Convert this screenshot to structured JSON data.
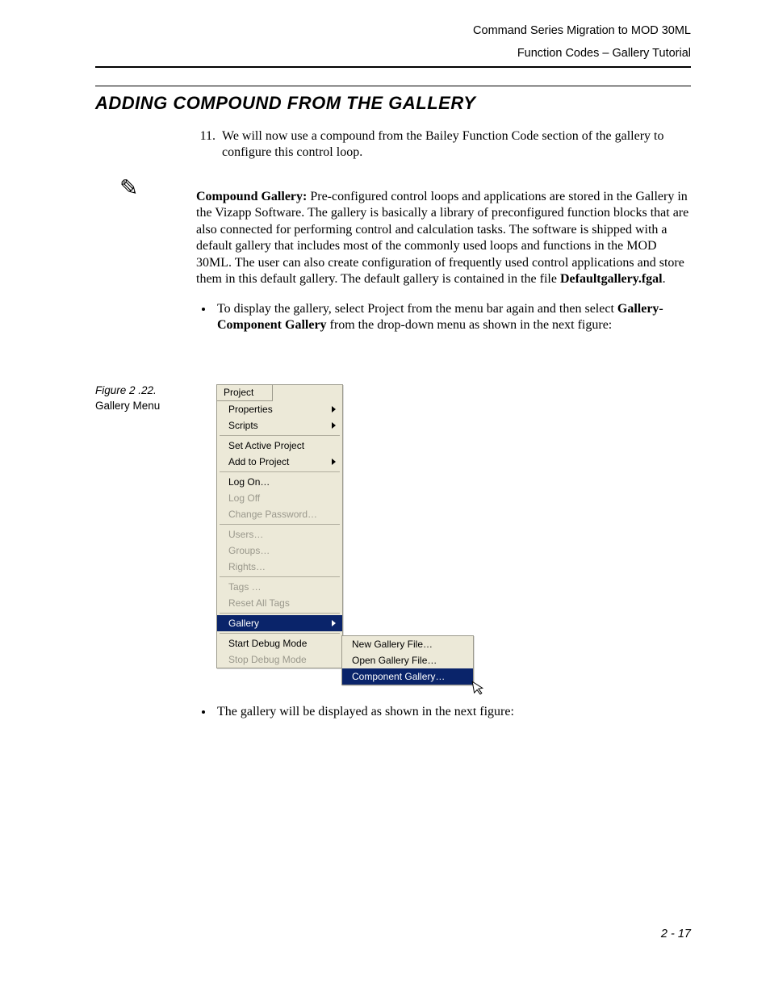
{
  "header": {
    "line1": "Command Series Migration to MOD 30ML",
    "line2": "Function Codes – Gallery Tutorial"
  },
  "section_title": "ADDING COMPOUND FROM THE GALLERY",
  "list_start": 11,
  "step11": "We will now use a compound from the Bailey Function Code section of the gallery to configure this control loop.",
  "note": {
    "lead": "Compound Gallery:",
    "body": " Pre-configured control loops and applications are stored in the Gallery in the Vizapp Software. The gallery is basically a library of preconfigured function blocks that are also connected for performing control and calculation tasks. The software is shipped with a default gallery that includes most of the commonly used loops and functions in the MOD 30ML. The user can also create configuration of frequently used control applications and store them in this default gallery. The default gallery is contained in the file ",
    "file": "Defaultgallery.fgal",
    "tail": "."
  },
  "bullet1": {
    "a": "To display the gallery, select Project from the menu bar again and then select ",
    "b": "Gallery-Component Gallery",
    "c": " from the drop-down menu as shown in the next figure:"
  },
  "figure": {
    "num": "Figure 2 .22.",
    "caption": "Gallery Menu"
  },
  "menu": {
    "header": "Project",
    "items": [
      {
        "label": "Properties",
        "submenu": true
      },
      {
        "label": "Scripts",
        "submenu": true
      },
      {
        "sep": true
      },
      {
        "label": "Set Active Project"
      },
      {
        "label": "Add to Project",
        "submenu": true
      },
      {
        "sep": true
      },
      {
        "label": "Log On…"
      },
      {
        "label": "Log Off",
        "disabled": true
      },
      {
        "label": "Change Password…",
        "disabled": true
      },
      {
        "sep": true
      },
      {
        "label": "Users…",
        "disabled": true
      },
      {
        "label": "Groups…",
        "disabled": true
      },
      {
        "label": "Rights…",
        "disabled": true
      },
      {
        "sep": true
      },
      {
        "label": "Tags …",
        "disabled": true
      },
      {
        "label": "Reset All Tags",
        "disabled": true
      },
      {
        "sep": true
      },
      {
        "label": "Gallery",
        "submenu": true,
        "highlight": true
      },
      {
        "sep": true
      },
      {
        "label": "Start Debug Mode"
      },
      {
        "label": "Stop Debug Mode",
        "disabled": true
      }
    ],
    "submenu": [
      {
        "label": "New Gallery File…"
      },
      {
        "label": "Open Gallery File…"
      },
      {
        "label": "Component Gallery…",
        "highlight": true
      }
    ]
  },
  "bullet2": "The gallery will be displayed as shown in the next figure:",
  "page_number": "2 - 17"
}
